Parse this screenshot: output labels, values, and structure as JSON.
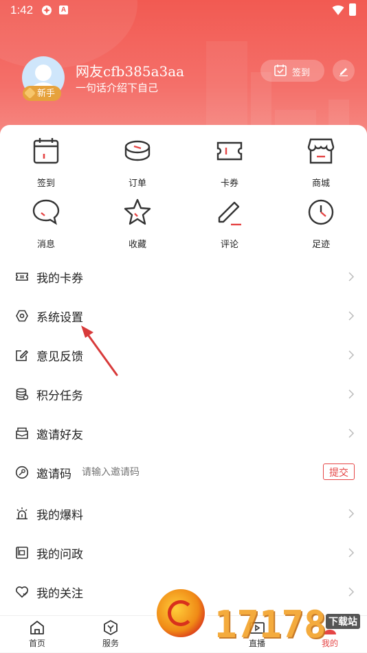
{
  "status_bar": {
    "time": "1:42"
  },
  "profile": {
    "username": "网友cfb385a3aa",
    "bio": "一句话介绍下自己",
    "badge": "新手",
    "checkin_label": "签到"
  },
  "quick_grid": [
    {
      "label": "签到",
      "icon": "calendar-icon"
    },
    {
      "label": "订单",
      "icon": "order-icon"
    },
    {
      "label": "卡券",
      "icon": "ticket-icon"
    },
    {
      "label": "商城",
      "icon": "store-icon"
    },
    {
      "label": "消息",
      "icon": "message-icon"
    },
    {
      "label": "收藏",
      "icon": "star-icon"
    },
    {
      "label": "评论",
      "icon": "pen-icon"
    },
    {
      "label": "足迹",
      "icon": "clock-icon"
    }
  ],
  "menu": [
    {
      "label": "我的卡券",
      "icon": "ticket-icon"
    },
    {
      "label": "系统设置",
      "icon": "settings-icon"
    },
    {
      "label": "意见反馈",
      "icon": "feedback-icon"
    },
    {
      "label": "积分任务",
      "icon": "coins-icon"
    },
    {
      "label": "邀请好友",
      "icon": "invite-icon"
    },
    {
      "label": "邀请码",
      "icon": "code-icon",
      "placeholder": "请输入邀请码",
      "submit": "提交"
    },
    {
      "label": "我的爆料",
      "icon": "alarm-icon"
    },
    {
      "label": "我的问政",
      "icon": "inquiry-icon"
    },
    {
      "label": "我的关注",
      "icon": "heart-icon"
    }
  ],
  "tabs": [
    {
      "label": "首页",
      "icon": "home-icon"
    },
    {
      "label": "服务",
      "icon": "service-icon"
    },
    {
      "label": "直播",
      "icon": "live-icon"
    },
    {
      "label": "我的",
      "icon": "profile-icon"
    }
  ],
  "watermark": {
    "text": "17178",
    "site": "下载站"
  },
  "colors": {
    "accent": "#f25a52",
    "danger": "#e54545",
    "header_top": "#f25a52",
    "header_bottom": "#f6938d"
  }
}
